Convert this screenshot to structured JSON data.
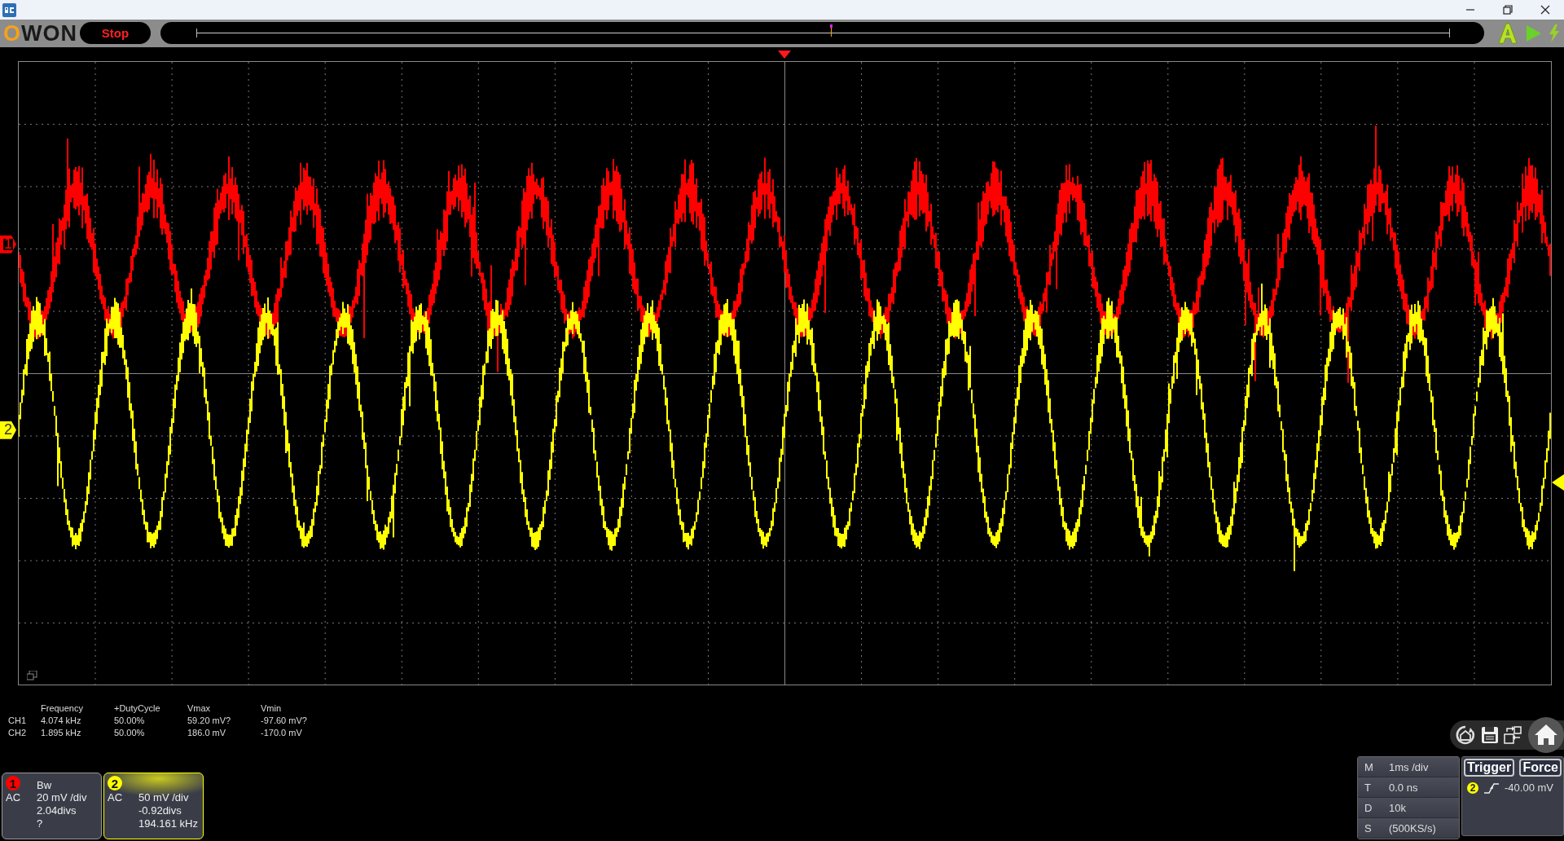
{
  "title_bar": {
    "controls": [
      {
        "kind": "minimize"
      },
      {
        "kind": "restore"
      },
      {
        "kind": "close"
      }
    ]
  },
  "toolbar": {
    "logo": "OWON",
    "run_button": "Stop",
    "actions": [
      {
        "kind": "auto"
      },
      {
        "kind": "run"
      },
      {
        "kind": "force"
      }
    ]
  },
  "measurements": {
    "columns": [
      "Frequency",
      "+DutyCycle",
      "Vmax",
      "Vmin"
    ],
    "rows": [
      {
        "channel": "CH1",
        "values": [
          "4.074 kHz",
          "50.00%",
          "59.20 mV?",
          "-97.60 mV?"
        ]
      },
      {
        "channel": "CH2",
        "values": [
          "1.895 kHz",
          "50.00%",
          "186.0 mV",
          "-170.0 mV"
        ]
      }
    ]
  },
  "channels": [
    {
      "marker": "1",
      "badge": "1",
      "color": "#ff0000",
      "selected": false,
      "coupling": "AC",
      "bandwidth": "Bw",
      "scale": "20 mV /div",
      "offset": "2.04divs",
      "frequency": "?"
    },
    {
      "marker": "2",
      "badge": "2",
      "color": "#ffff00",
      "selected": true,
      "coupling": "AC",
      "scale": "50 mV /div",
      "offset": "-0.92divs",
      "frequency": "194.161 kHz"
    }
  ],
  "tools": [
    {
      "kind": "home-cycle"
    },
    {
      "kind": "save"
    },
    {
      "kind": "swap"
    },
    {
      "kind": "home"
    }
  ],
  "timebase": [
    {
      "key": "M",
      "value": "1ms /div"
    },
    {
      "key": "T",
      "value": "0.0 ns"
    },
    {
      "key": "D",
      "value": "10k"
    },
    {
      "key": "S",
      "value": "(500KS/s)"
    }
  ],
  "trigger": {
    "buttons": [
      "Trigger",
      "Force"
    ],
    "source": "2",
    "level": "-40.00 mV"
  }
}
